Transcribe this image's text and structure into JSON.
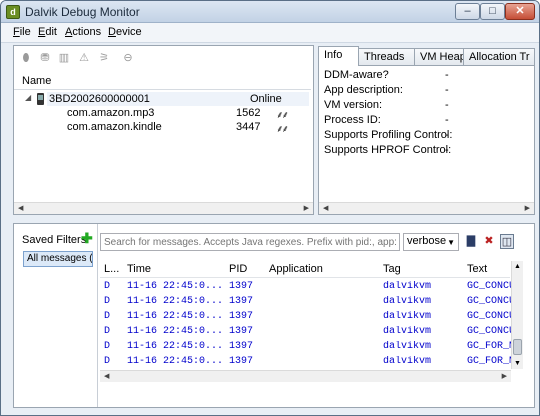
{
  "window": {
    "title": "Dalvik Debug Monitor",
    "min": "–",
    "max": "□",
    "close": "✕"
  },
  "menu": {
    "file": {
      "accel": "F",
      "rest": "ile"
    },
    "edit": {
      "accel": "E",
      "rest": "dit"
    },
    "actions": {
      "accel": "A",
      "rest": "ctions"
    },
    "device": {
      "accel": "D",
      "rest": "evice"
    }
  },
  "devices": {
    "name_header": "Name",
    "device": {
      "serial": "3BD2002600000001",
      "state": "Online"
    },
    "clients": [
      {
        "name": "com.amazon.mp3",
        "pid": "1562",
        "icon": "debug-bug-icon"
      },
      {
        "name": "com.amazon.kindle",
        "pid": "3447",
        "icon": "debug-bug-icon"
      }
    ]
  },
  "tabs": [
    "Info",
    "Threads",
    "VM Heap",
    "Allocation Tr"
  ],
  "info": {
    "rows": [
      {
        "label": "DDM-aware?",
        "value": "-"
      },
      {
        "label": "App description:",
        "value": "-"
      },
      {
        "label": "VM version:",
        "value": "-"
      },
      {
        "label": "Process ID:",
        "value": "-"
      },
      {
        "label": "Supports Profiling Control:",
        "value": "-"
      },
      {
        "label": "Supports HPROF Control:",
        "value": "-"
      }
    ]
  },
  "logcat": {
    "saved_filters_label": "Saved Filters",
    "all_messages": "All messages (n",
    "search_placeholder": "Search for messages. Accepts Java regexes. Prefix with pid:, app:, tag: or",
    "level_select": "verbose",
    "columns": [
      "L...",
      "Time",
      "PID",
      "Application",
      "Tag",
      "Text"
    ],
    "rows": [
      {
        "level": "D",
        "time": "11-16 22:45:0...",
        "pid": "1397",
        "app": "",
        "tag": "dalvikvm",
        "text": "GC_CONCUR"
      },
      {
        "level": "D",
        "time": "11-16 22:45:0...",
        "pid": "1397",
        "app": "",
        "tag": "dalvikvm",
        "text": "GC_CONCUR"
      },
      {
        "level": "D",
        "time": "11-16 22:45:0...",
        "pid": "1397",
        "app": "",
        "tag": "dalvikvm",
        "text": "GC_CONCUR"
      },
      {
        "level": "D",
        "time": "11-16 22:45:0...",
        "pid": "1397",
        "app": "",
        "tag": "dalvikvm",
        "text": "GC_CONCUR"
      },
      {
        "level": "D",
        "time": "11-16 22:45:0...",
        "pid": "1397",
        "app": "",
        "tag": "dalvikvm",
        "text": "GC_FOR_M"
      },
      {
        "level": "D",
        "time": "11-16 22:45:0...",
        "pid": "1397",
        "app": "",
        "tag": "dalvikvm",
        "text": "GC_FOR_M"
      }
    ]
  },
  "colors": {
    "log_text": "#0000cc",
    "add_filter": "#22aa22",
    "selection": "#dce9f8"
  }
}
